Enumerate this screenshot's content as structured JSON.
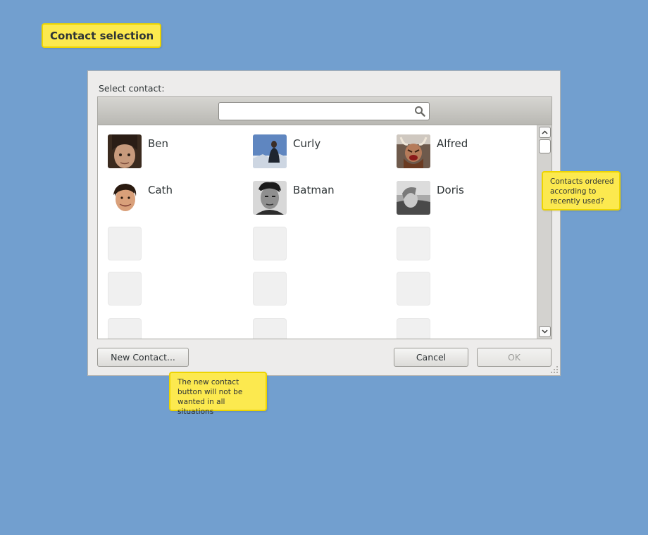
{
  "page_title_note": "Contact selection",
  "dialog": {
    "prompt": "Select contact:",
    "search": {
      "value": "",
      "placeholder": "",
      "icon": "search-icon"
    },
    "contacts": [
      {
        "name": "Ben"
      },
      {
        "name": "Curly"
      },
      {
        "name": "Alfred"
      },
      {
        "name": "Cath"
      },
      {
        "name": "Batman"
      },
      {
        "name": "Doris"
      }
    ],
    "buttons": {
      "new_contact": "New Contact...",
      "cancel": "Cancel",
      "ok": "OK"
    }
  },
  "notes": {
    "ordering": "Contacts ordered according to recently used?",
    "new_contact": "The new contact button will not be wanted in all situations"
  },
  "colors": {
    "background": "#729fcf",
    "note": "#fce94f"
  }
}
